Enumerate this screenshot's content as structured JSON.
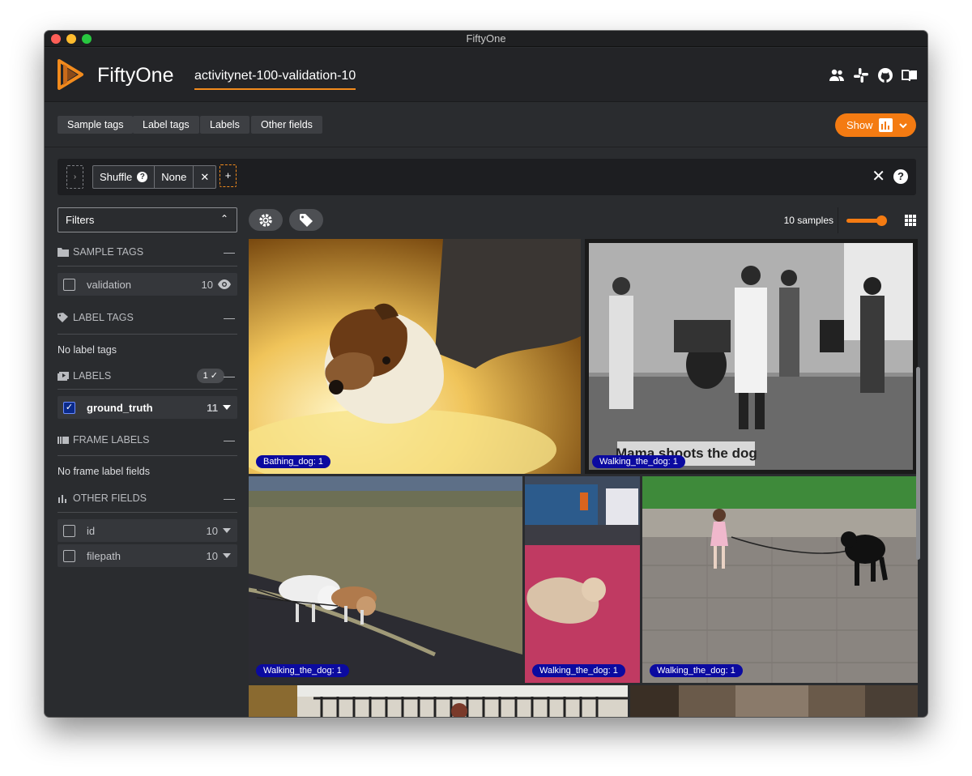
{
  "window": {
    "title": "FiftyOne"
  },
  "header": {
    "brand": "FiftyOne",
    "dataset": "activitynet-100-validation-10",
    "icons": [
      "team-icon",
      "slack-icon",
      "github-icon",
      "docs-book-icon"
    ]
  },
  "toolbar": {
    "tabs": [
      "Sample tags",
      "Label tags",
      "Labels",
      "Other fields"
    ],
    "show_label": "Show"
  },
  "view_bar": {
    "stage_name": "Shuffle",
    "stage_value": "None"
  },
  "sidebar": {
    "filters_label": "Filters",
    "groups": {
      "sample_tags": {
        "title": "SAMPLE TAGS",
        "items": [
          {
            "label": "validation",
            "count": "10",
            "checked": false
          }
        ]
      },
      "label_tags": {
        "title": "LABEL TAGS",
        "empty": "No label tags"
      },
      "labels": {
        "title": "LABELS",
        "badge": "1 ✓",
        "items": [
          {
            "label": "ground_truth",
            "count": "11",
            "checked": true
          }
        ]
      },
      "frame_labels": {
        "title": "FRAME LABELS",
        "empty": "No frame label fields"
      },
      "other_fields": {
        "title": "OTHER FIELDS",
        "items": [
          {
            "label": "id",
            "count": "10",
            "checked": false
          },
          {
            "label": "filepath",
            "count": "10",
            "checked": false
          }
        ]
      }
    }
  },
  "grid": {
    "samples_label": "10 samples",
    "tiles": [
      {
        "label": "Bathing_dog: 1"
      },
      {
        "label": "Walking_the_dog: 1",
        "caption": "Mama shoots the dog"
      },
      {
        "label": "Walking_the_dog: 1"
      },
      {
        "label": "Walking_the_dog: 1"
      },
      {
        "label": "Walking_the_dog: 1"
      }
    ]
  },
  "colors": {
    "accent": "#f47b12",
    "label_pill": "#0b0aa0",
    "checkbox_checked": "#0a2a8a"
  }
}
